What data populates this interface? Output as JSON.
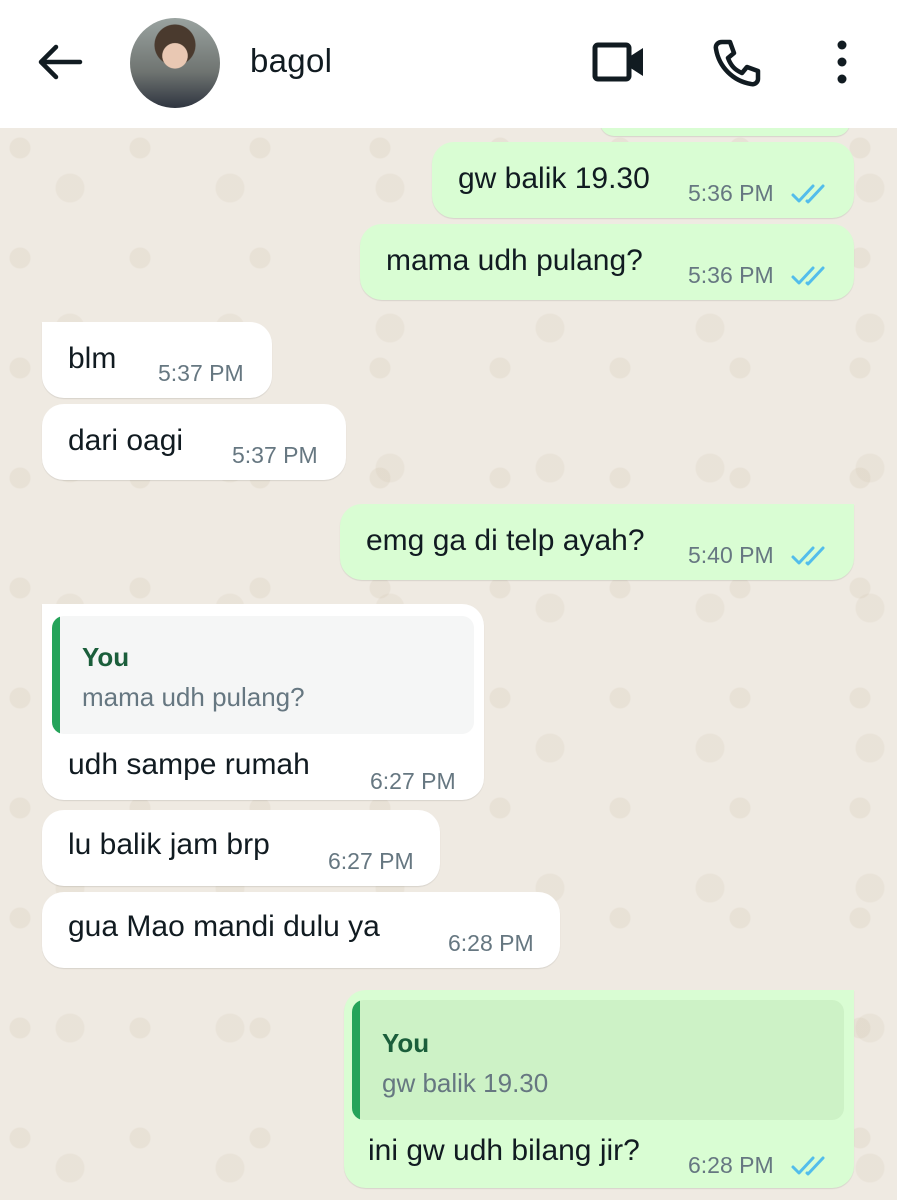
{
  "header": {
    "contact_name": "bagol",
    "icons": [
      "back-arrow-icon",
      "video-call-icon",
      "phone-call-icon",
      "more-options-icon"
    ]
  },
  "messages": [
    {
      "direction": "out",
      "text": "gw balik 19.30",
      "time": "5:36 PM",
      "status": "read"
    },
    {
      "direction": "out",
      "text": "mama udh pulang?",
      "time": "5:36 PM",
      "status": "read"
    },
    {
      "direction": "in",
      "text": "blm",
      "time": "5:37 PM"
    },
    {
      "direction": "in",
      "text": "dari oagi",
      "time": "5:37 PM"
    },
    {
      "direction": "out",
      "text": "emg ga di telp ayah?",
      "time": "5:40 PM",
      "status": "read"
    },
    {
      "direction": "in",
      "quote": {
        "author": "You",
        "text": "mama udh pulang?"
      },
      "text": "udh sampe rumah",
      "time": "6:27 PM"
    },
    {
      "direction": "in",
      "text": "lu balik jam brp",
      "time": "6:27 PM"
    },
    {
      "direction": "in",
      "text": "gua Mao mandi dulu ya",
      "time": "6:28 PM"
    },
    {
      "direction": "out",
      "quote": {
        "author": "You",
        "text": "gw balik 19.30"
      },
      "text": "ini gw udh bilang jir?",
      "time": "6:28 PM",
      "status": "read"
    }
  ],
  "colors": {
    "outgoing_bubble": "#d9fdd3",
    "incoming_bubble": "#ffffff",
    "chat_background": "#efeae2",
    "read_ticks": "#53bdeb",
    "quote_bar": "#25a35a"
  }
}
